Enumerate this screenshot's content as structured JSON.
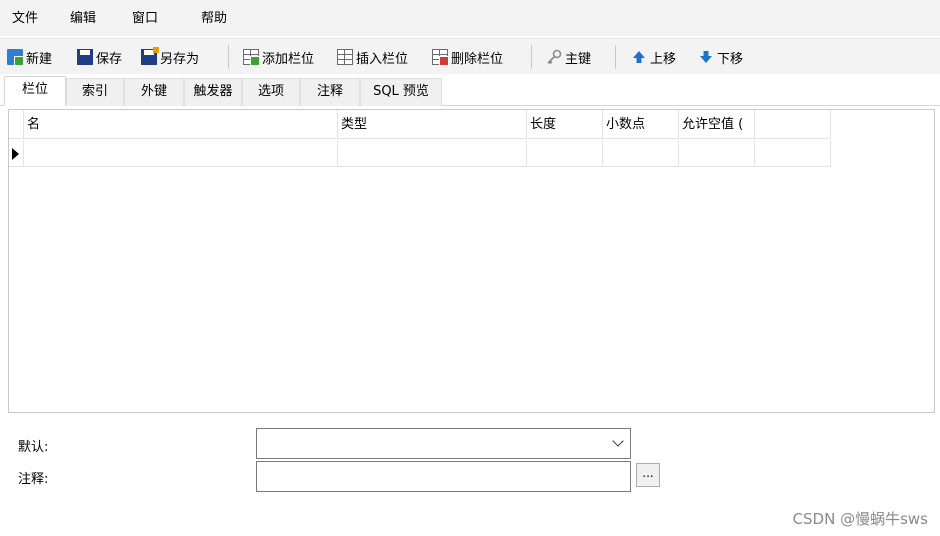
{
  "menu": [
    "文件",
    "编辑",
    "窗口",
    "帮助"
  ],
  "toolbar": {
    "new": "新建",
    "save": "保存",
    "save_as": "另存为",
    "add_column": "添加栏位",
    "insert_column": "插入栏位",
    "delete_column": "删除栏位",
    "primary_key": "主键",
    "move_up": "上移",
    "move_down": "下移"
  },
  "tabs": [
    "栏位",
    "索引",
    "外键",
    "触发器",
    "选项",
    "注释",
    "SQL 预览"
  ],
  "grid": {
    "columns": [
      "名",
      "类型",
      "长度",
      "小数点",
      "允许空值 (",
      ""
    ]
  },
  "form": {
    "default_label": "默认:",
    "default_value": "",
    "comment_label": "注释:",
    "comment_value": "",
    "dots": "..."
  },
  "watermark": "CSDN @慢蜗牛sws"
}
